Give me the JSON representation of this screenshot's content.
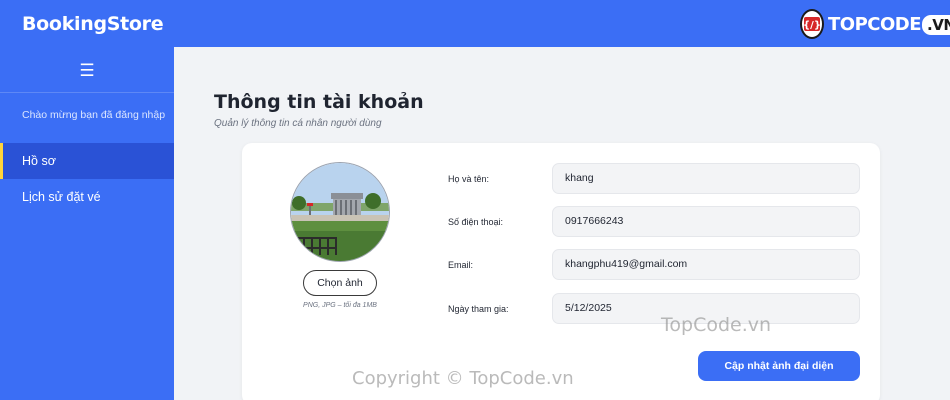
{
  "header": {
    "brand": "BookingStore",
    "logo_text": "TOPCODE",
    "logo_suffix": ".VN",
    "menu_icon": "☰"
  },
  "sidebar": {
    "welcome": "Chào mừng bạn đã đăng nhập",
    "items": [
      {
        "label": "Hồ sơ",
        "active": true
      },
      {
        "label": "Lịch sử đặt vé",
        "active": false
      }
    ]
  },
  "page": {
    "title": "Thông tin tài khoản",
    "subtitle": "Quản lý thông tin cá nhân người dùng"
  },
  "profile": {
    "choose_image_label": "Chọn ảnh",
    "file_hint": "PNG, JPG – tối đa 1MB",
    "fields": [
      {
        "label": "Họ và tên:",
        "value": "khang"
      },
      {
        "label": "Số điện thoại:",
        "value": "0917666243"
      },
      {
        "label": "Email:",
        "value": "khangphu419@gmail.com"
      },
      {
        "label": "Ngày tham gia:",
        "value": "5/12/2025"
      }
    ],
    "update_button": "Cập nhật ảnh đại diện"
  },
  "watermarks": {
    "top": "TopCode.vn",
    "bottom": "Copyright © TopCode.vn"
  },
  "colors": {
    "primary": "#3b6ef5",
    "sidebar_active": "#2a52d6",
    "active_indicator": "#ffd43b"
  }
}
